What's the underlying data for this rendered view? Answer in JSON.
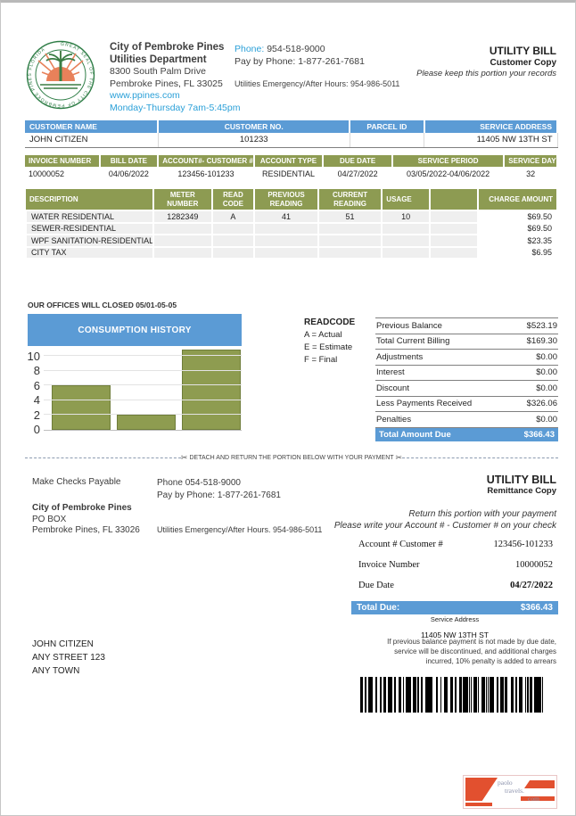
{
  "colors": {
    "accent_blue": "#5b9bd5",
    "olive": "#8d9b52",
    "bar_fill": "#8e9c50",
    "link_blue": "#2ba0d8",
    "watermark_orange": "#e2502f"
  },
  "header": {
    "seal_text": "GREAT SEAL OF THE CITY OF PEMBROKE PINES FLORIDA",
    "org_line1": "City of Pembroke Pines",
    "org_line2": "Utilities Department",
    "org_line3": "8300 South Palm Drive",
    "org_line4": "Pembroke Pines, FL 33025",
    "website": "www.ppines.com",
    "hours": "Monday-Thursday 7am-5:45pm",
    "phone_label": "Phone:",
    "phone_number": " 954-518-9000",
    "pay_by_phone": "Pay by Phone: 1-877-261-7681",
    "emergency": "Utilities Emergency/After Hours: 954-986-5011",
    "bill_title": "UTILITY BILL",
    "copy_type": "Customer Copy",
    "keep_note": "Please keep this portion your records"
  },
  "customer": {
    "headers": [
      "CUSTOMER NAME",
      "CUSTOMER NO.",
      "PARCEL ID",
      "SERVICE ADDRESS"
    ],
    "row": [
      "JOHN CITIZEN",
      "101233",
      "",
      "11405 NW 13TH ST"
    ]
  },
  "invoice": {
    "headers": [
      "INVOICE NUMBER",
      "BILL DATE",
      "ACCOUNT#- CUSTOMER #",
      "ACCOUNT TYPE",
      "DUE DATE",
      "SERVICE PERIOD",
      "SERVICE DAYS"
    ],
    "row": [
      "10000052",
      "04/06/2022",
      "123456-101233",
      "RESIDENTIAL",
      "04/27/2022",
      "03/05/2022-04/06/2022",
      "32"
    ]
  },
  "charges": {
    "headers": [
      "DESCRIPTION",
      "METER NUMBER",
      "READ CODE",
      "PREVIOUS READING",
      "CURRENT READING",
      "USAGE",
      "CHARGE AMOUNT"
    ],
    "rows": [
      [
        "WATER RESIDENTIAL",
        "1282349",
        "A",
        "41",
        "51",
        "10",
        "$69.50"
      ],
      [
        "SEWER-RESIDENTIAL",
        "",
        "",
        "",
        "",
        "",
        "$69.50"
      ],
      [
        "WPF SANITATION-RESIDENTIAL",
        "",
        "",
        "",
        "",
        "",
        "$23.35"
      ],
      [
        "CITY TAX",
        "",
        "",
        "",
        "",
        "",
        "$6.95"
      ]
    ]
  },
  "office_notice": "OUR OFFICES WILL CLOSED 05/01-05-05",
  "chart_data": {
    "type": "bar",
    "title": "CONSUMPTION HISTORY",
    "categories": [
      "",
      "",
      ""
    ],
    "values": [
      6,
      2,
      10.8
    ],
    "yticks": [
      0,
      2,
      4,
      6,
      8,
      10
    ],
    "ymax": 10,
    "ylim": [
      0,
      10
    ],
    "xlabel": "",
    "ylabel": "",
    "grid": true,
    "legend_position": "none",
    "bar_color": "#8e9c50"
  },
  "readcode": {
    "title": "READCODE",
    "items": [
      "A = Actual",
      "E = Estimate",
      "F = Final"
    ]
  },
  "summary": {
    "rows": [
      {
        "label": "Previous Balance",
        "value": "$523.19"
      },
      {
        "label": "Total Current Billing",
        "value": "$169.30"
      },
      {
        "label": "Adjustments",
        "value": "$0.00"
      },
      {
        "label": "Interest",
        "value": "$0.00"
      },
      {
        "label": "Discount",
        "value": "$0.00"
      },
      {
        "label": "Less Payments Received",
        "value": "$326.06"
      },
      {
        "label": "Penalties",
        "value": "$0.00"
      }
    ],
    "total_label": "Total Amount Due",
    "total_value": "$366.43"
  },
  "detach_text": "DETACH AND RETURN THE PORTION BELOW WITH YOUR PAYMENT",
  "scissors": "✂",
  "remittance": {
    "make_checks": "Make Checks Payable",
    "payee_name": "City of Pembroke Pines",
    "payee_line2": "PO BOX",
    "payee_line3": "Pembroke Pines, FL 33026",
    "phone": "Phone 054-518-9000",
    "pay_by_phone": "Pay by Phone: 1-877-261-7681",
    "emergency": "Utilities Emergency/After Hours. 954-986-5011",
    "bill_title": "UTILITY BILL",
    "copy_type": "Remittance Copy",
    "return_line1": "Return this portion with your payment",
    "return_line2": "Please write your Account # - Customer # on your check"
  },
  "remit_details": {
    "rows": [
      {
        "label": "Account # Customer #",
        "value": "123456-101233"
      },
      {
        "label": "Invoice Number",
        "value": "10000052"
      },
      {
        "label": "Due Date",
        "value": "04/27/2022"
      }
    ],
    "total_label": "Total Due:",
    "total_value": "$366.43",
    "service_address_label": "Service Address",
    "service_address": "11405 NW 13TH ST"
  },
  "mailing": [
    "JOHN CITIZEN",
    "ANY STREET 123",
    "ANY TOWN"
  ],
  "fine_print": [
    "If previous balance payment is not made by due date,",
    "service will be discontinued, and additional charges",
    "incurred, 10% penalty is added to arrears"
  ],
  "watermark": {
    "line1": "paolo",
    "line2": "travels.",
    "line3": "com"
  }
}
